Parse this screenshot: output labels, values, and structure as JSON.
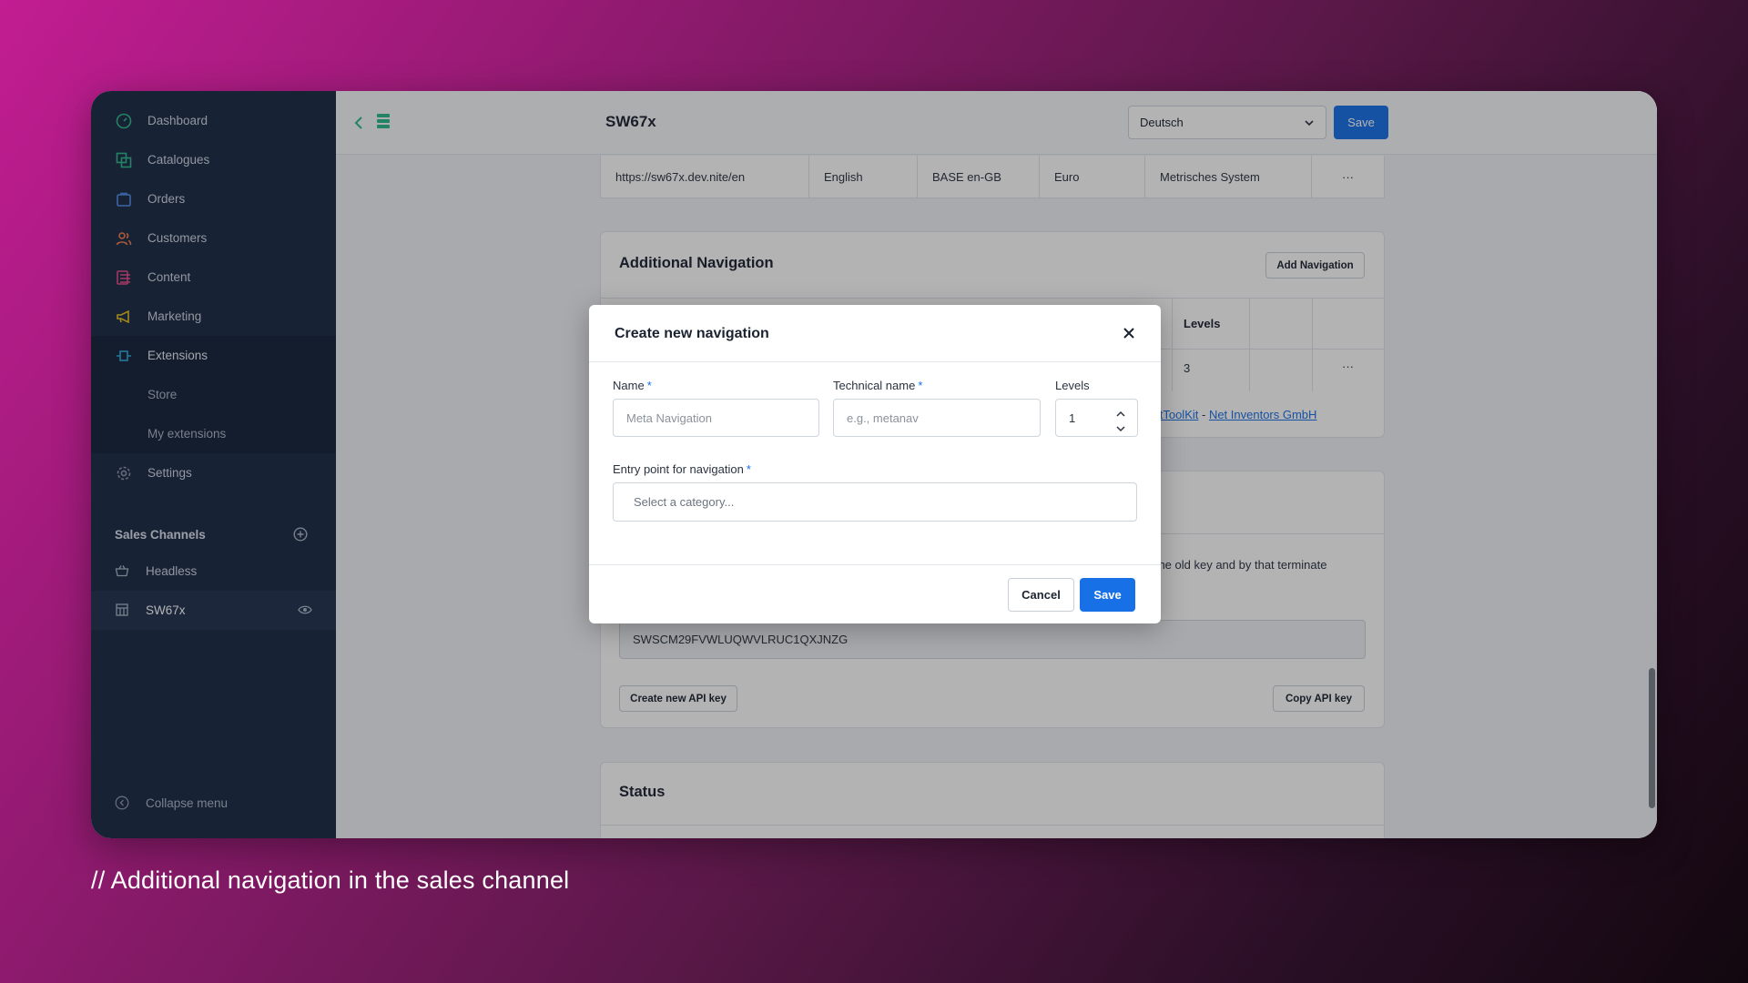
{
  "sidebar": {
    "items": [
      {
        "label": "Dashboard",
        "icon": "dashboard-icon"
      },
      {
        "label": "Catalogues",
        "icon": "catalogue-icon"
      },
      {
        "label": "Orders",
        "icon": "orders-icon"
      },
      {
        "label": "Customers",
        "icon": "customers-icon"
      },
      {
        "label": "Content",
        "icon": "content-icon"
      },
      {
        "label": "Marketing",
        "icon": "marketing-icon"
      },
      {
        "label": "Extensions",
        "icon": "extensions-icon"
      },
      {
        "label": "Settings",
        "icon": "settings-icon"
      }
    ],
    "sub_items": [
      "Store",
      "My extensions"
    ],
    "sales_channels_title": "Sales Channels",
    "sales_channels": [
      {
        "label": "Headless",
        "icon": "basket-icon"
      },
      {
        "label": "SW67x",
        "icon": "storefront-icon"
      }
    ],
    "collapse_label": "Collapse menu"
  },
  "topbar": {
    "title": "SW67x",
    "language": "Deutsch",
    "save_label": "Save"
  },
  "domain_row": {
    "url": "https://sw67x.dev.nite/en",
    "language": "English",
    "snippet_set": "BASE en-GB",
    "currency": "Euro",
    "measurement": "Metrisches System",
    "actions": "···"
  },
  "additional_navigation": {
    "title": "Additional Navigation",
    "add_button": "Add Navigation",
    "column_levels": "Levels",
    "row_levels": "3",
    "row_actions": "···",
    "link_text_1": "extToolKit",
    "link_separator": " - ",
    "link_text_2": "Net Inventors GmbH"
  },
  "api_section": {
    "partial_text": "e the old key and by that terminate",
    "api_key": "SWSCM29FVWLUQWVLRUC1QXJNZG",
    "create_button": "Create new API key",
    "copy_button": "Copy API key"
  },
  "status_section": {
    "title": "Status"
  },
  "modal": {
    "title": "Create new navigation",
    "name_label": "Name",
    "name_placeholder": "Meta Navigation",
    "tech_label": "Technical name",
    "tech_placeholder": "e.g., metanav",
    "levels_label": "Levels",
    "levels_value": "1",
    "entry_label": "Entry point for navigation",
    "entry_placeholder": "Select a category...",
    "required_mark": "*",
    "cancel_label": "Cancel",
    "save_label": "Save"
  },
  "caption": "//  Additional navigation in the sales channel",
  "colors": {
    "accent": "#1870e6",
    "sidebar_bg": "#1b2a44"
  }
}
